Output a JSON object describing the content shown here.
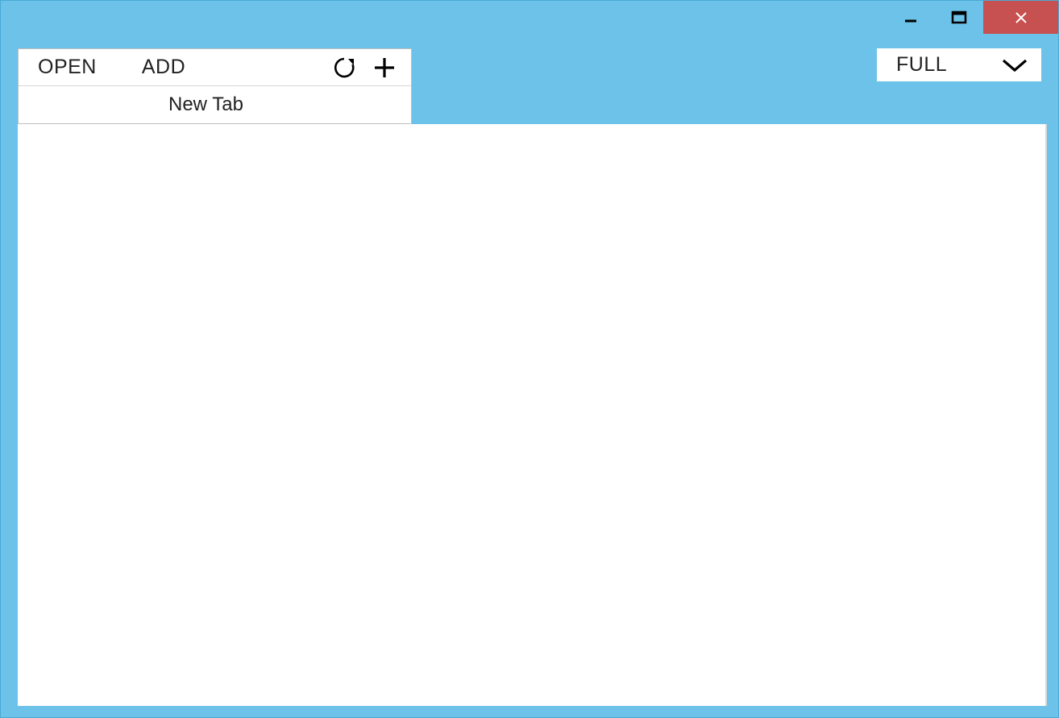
{
  "toolbar": {
    "open_label": "OPEN",
    "add_label": "ADD"
  },
  "tabs": {
    "active_label": "New Tab"
  },
  "view_mode": {
    "selected": "FULL"
  },
  "colors": {
    "chrome": "#6cc2e8",
    "close_button": "#c75050"
  }
}
